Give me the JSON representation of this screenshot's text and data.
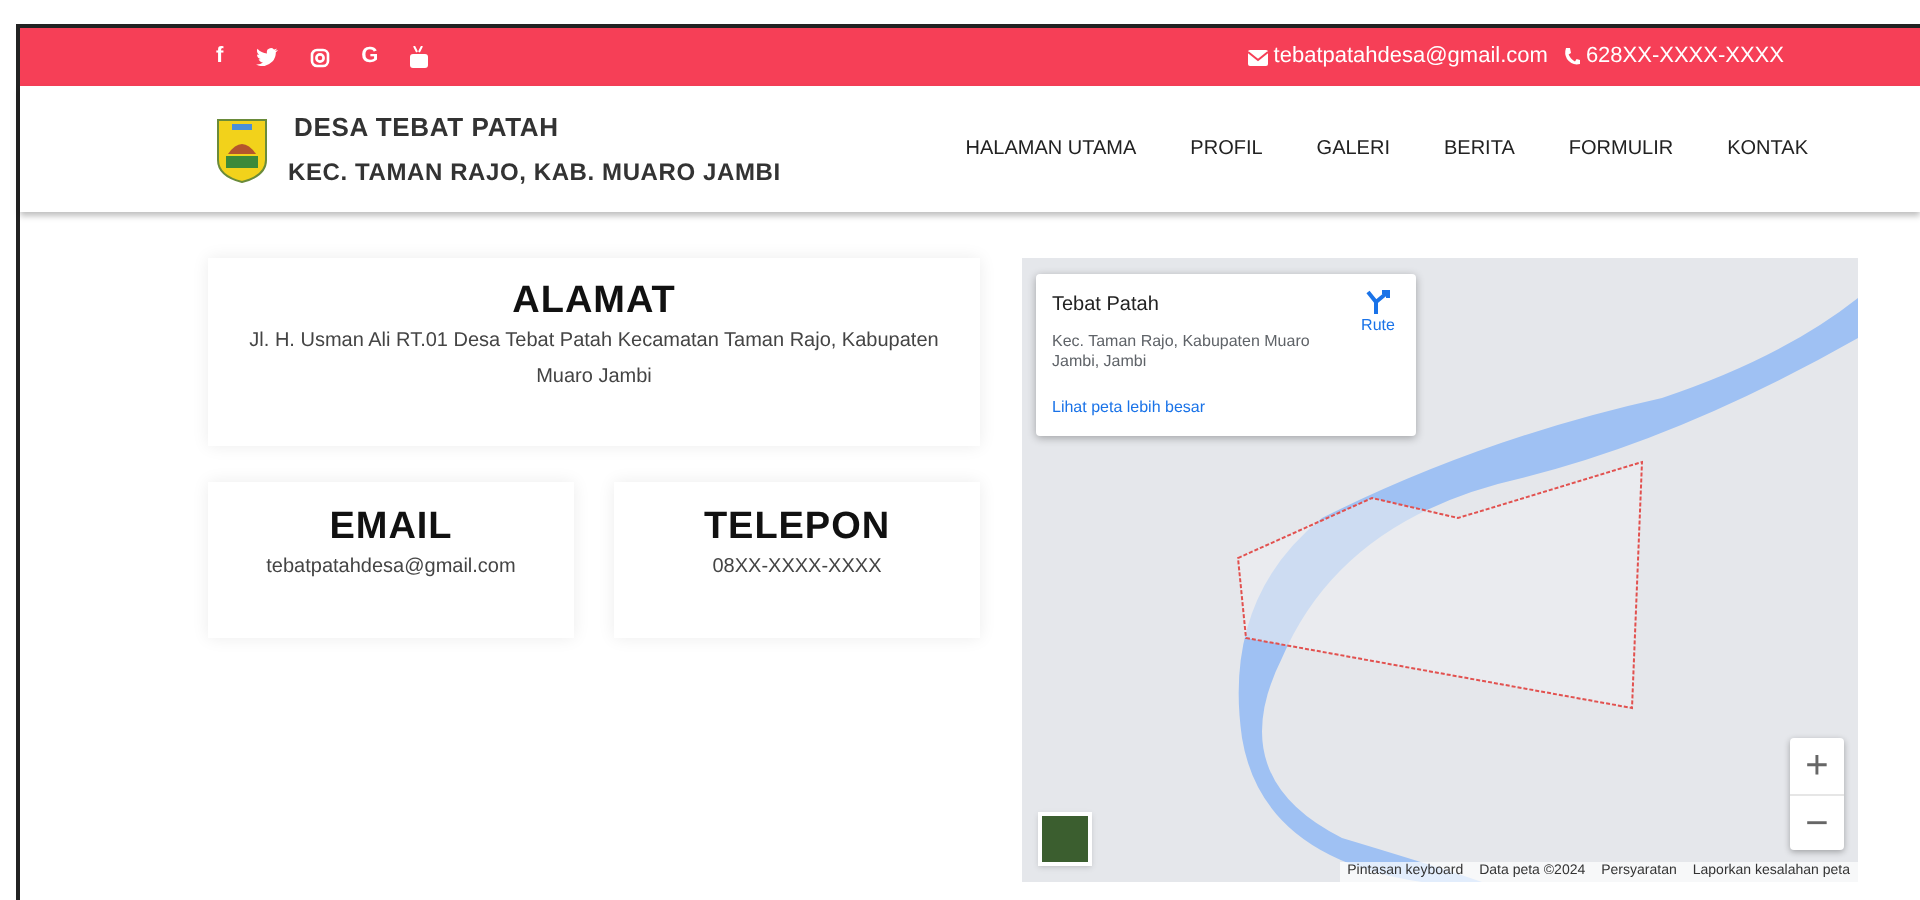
{
  "topbar": {
    "social": [
      {
        "kind": "facebook",
        "label": "f"
      },
      {
        "kind": "twitter"
      },
      {
        "kind": "instagram"
      },
      {
        "kind": "google",
        "label": "G"
      },
      {
        "kind": "youtube"
      }
    ],
    "email": "tebatpatahdesa@gmail.com",
    "phone": "628XX-XXXX-XXXX"
  },
  "header": {
    "title": "DESA TEBAT PATAH",
    "subtitle": "KEC. TAMAN RAJO, KAB. MUARO JAMBI",
    "nav": [
      "HALAMAN UTAMA",
      "PROFIL",
      "GALERI",
      "BERITA",
      "FORMULIR",
      "KONTAK"
    ]
  },
  "cards": [
    {
      "title": "ALAMAT",
      "text": "Jl. H. Usman Ali RT.01 Desa Tebat Patah Kecamatan Taman Rajo, Kabupaten Muaro Jambi"
    },
    {
      "title": "EMAIL",
      "text": "tebatpatahdesa@gmail.com"
    },
    {
      "title": "TELEPON",
      "text": "08XX-XXXX-XXXX"
    }
  ],
  "map": {
    "place": {
      "name": "Tebat Patah",
      "address": "Kec. Taman Rajo, Kabupaten Muaro Jambi, Jambi",
      "route": "Rute",
      "larger_map": "Lihat peta lebih besar"
    },
    "zoom": {
      "in": "+",
      "out": "−"
    },
    "attribution": [
      "Pintasan keyboard",
      "Data peta ©2024",
      "Persyaratan",
      "Laporkan kesalahan peta"
    ]
  }
}
